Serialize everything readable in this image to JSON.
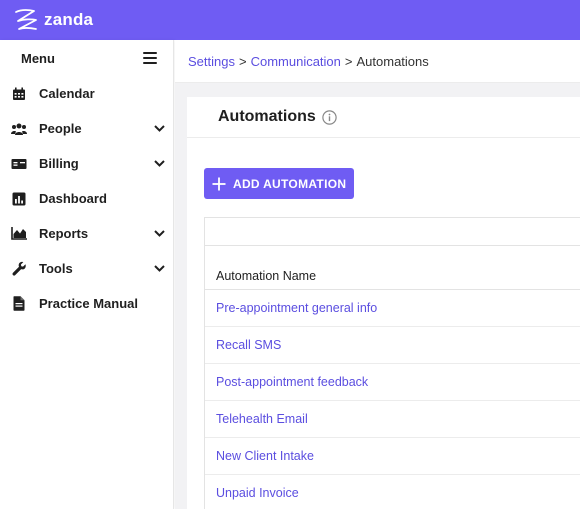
{
  "brand": {
    "name": "zanda",
    "color": "#6f5cf3",
    "link_color": "#5b4ee0"
  },
  "sidebar": {
    "title": "Menu",
    "items": [
      {
        "label": "Calendar",
        "icon": "calendar-icon",
        "expandable": false
      },
      {
        "label": "People",
        "icon": "people-icon",
        "expandable": true
      },
      {
        "label": "Billing",
        "icon": "billing-icon",
        "expandable": true
      },
      {
        "label": "Dashboard",
        "icon": "dashboard-icon",
        "expandable": false
      },
      {
        "label": "Reports",
        "icon": "reports-icon",
        "expandable": true
      },
      {
        "label": "Tools",
        "icon": "wrench-icon",
        "expandable": true
      },
      {
        "label": "Practice Manual",
        "icon": "document-icon",
        "expandable": false
      }
    ]
  },
  "breadcrumb": {
    "items": [
      "Settings",
      "Communication"
    ],
    "separator": ">",
    "current": "Automations"
  },
  "page": {
    "title": "Automations",
    "add_button_label": "ADD AUTOMATION"
  },
  "table": {
    "column_header": "Automation Name",
    "rows": [
      "Pre-appointment general info",
      "Recall SMS",
      "Post-appointment feedback",
      "Telehealth Email",
      "New Client Intake",
      "Unpaid Invoice"
    ]
  }
}
